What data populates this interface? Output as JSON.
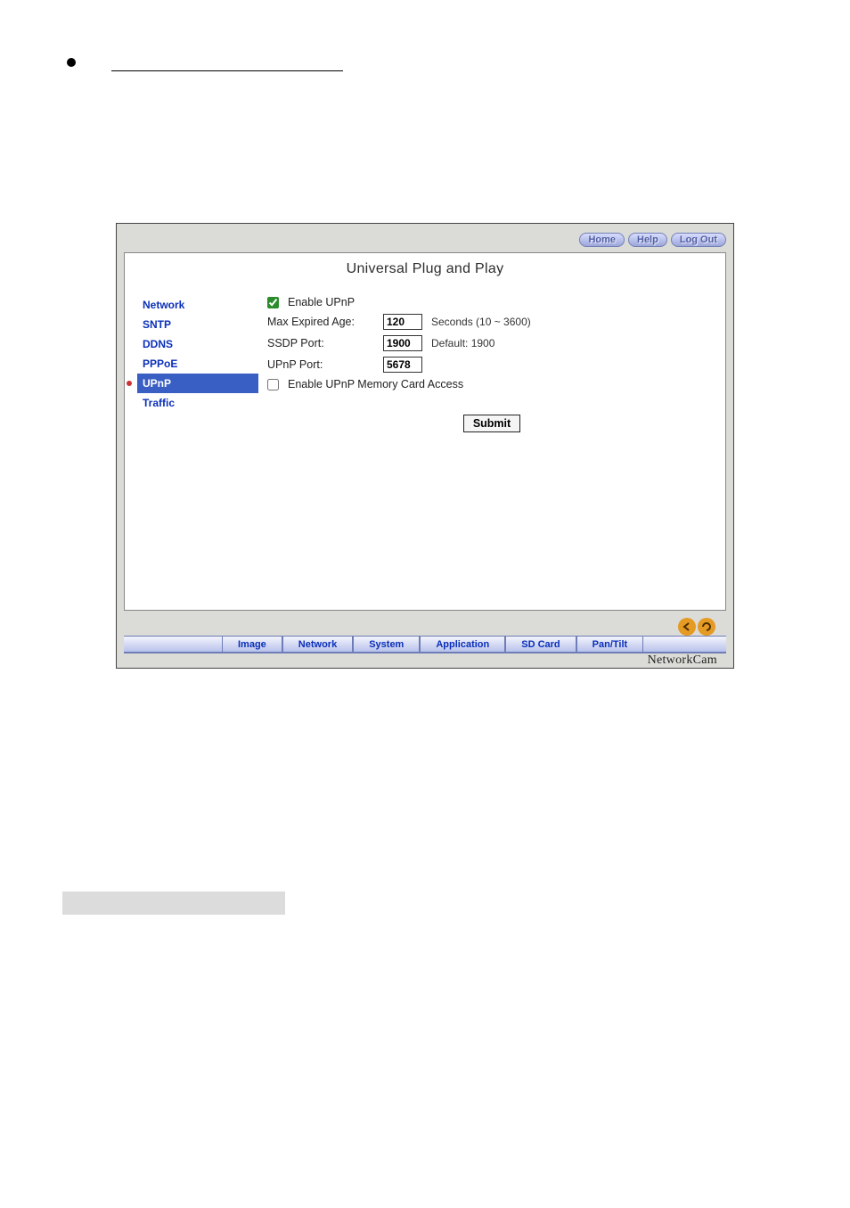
{
  "header": {
    "home": "Home",
    "help": "Help",
    "logout": "Log Out"
  },
  "title": "Universal Plug and Play",
  "sidebar": {
    "items": [
      {
        "label": "Network"
      },
      {
        "label": "SNTP"
      },
      {
        "label": "DDNS"
      },
      {
        "label": "PPPoE"
      },
      {
        "label": "UPnP"
      },
      {
        "label": "Traffic"
      }
    ]
  },
  "form": {
    "enable_label": "Enable UPnP",
    "max_expired_label": "Max Expired Age:",
    "max_expired_value": "120",
    "max_expired_hint": "Seconds (10 ~ 3600)",
    "ssdp_label": "SSDP Port:",
    "ssdp_value": "1900",
    "ssdp_hint": "Default: 1900",
    "upnp_port_label": "UPnP Port:",
    "upnp_port_value": "5678",
    "enable_mem_label": "Enable UPnP Memory Card Access",
    "submit": "Submit"
  },
  "tabs": {
    "image": "Image",
    "network": "Network",
    "system": "System",
    "application": "Application",
    "sdcard": "SD Card",
    "pantilt": "Pan/Tilt"
  },
  "brand": "NetworkCam"
}
